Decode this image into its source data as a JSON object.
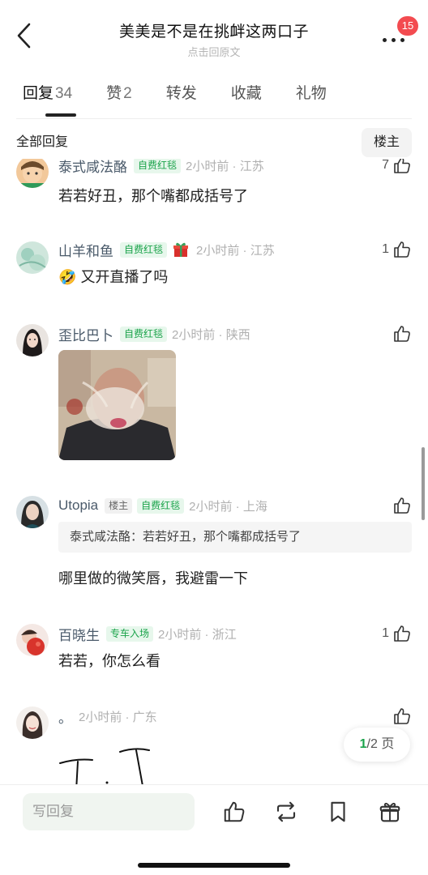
{
  "header": {
    "title": "美美是不是在挑衅这两口子",
    "subtitle": "点击回原文",
    "badge": "15"
  },
  "tabs": [
    {
      "label": "回复",
      "count": "34"
    },
    {
      "label": "赞",
      "count": "2"
    },
    {
      "label": "转发",
      "count": ""
    },
    {
      "label": "收藏",
      "count": ""
    },
    {
      "label": "礼物",
      "count": ""
    }
  ],
  "section": {
    "title": "全部回复",
    "owner_button": "楼主"
  },
  "comments": [
    {
      "name": "泰式咸法酪",
      "tag": "自费红毯",
      "time": "2小时前 · 江苏",
      "likes": "7",
      "text": "若若好丑，那个嘴都成括号了"
    },
    {
      "name": "山羊和鱼",
      "tag": "自费红毯",
      "time": "2小时前 · 江苏",
      "likes": "1",
      "emoji": "🤣",
      "text": "又开直播了吗"
    },
    {
      "name": "歪比巴卜",
      "tag": "自费红毯",
      "time": "2小时前 · 陕西",
      "likes": ""
    },
    {
      "name": "Utopia",
      "owner_tag": "楼主",
      "tag": "自费红毯",
      "time": "2小时前 · 上海",
      "likes": "",
      "quote": "泰式咸法酪：若若好丑，那个嘴都成括号了",
      "text": "哪里做的微笑唇，我避雷一下"
    },
    {
      "name": "百晓生",
      "tag": "专车入场",
      "time": "2小时前 · 浙江",
      "likes": "1",
      "text": "若若，你怎么看"
    },
    {
      "name": "。",
      "time": "2小时前 · 广东",
      "likes": ""
    }
  ],
  "pager": {
    "current": "1",
    "total": "/2 页"
  },
  "bottom": {
    "reply_placeholder": "写回复"
  },
  "colors": {
    "accent_green": "#1aa34a",
    "badge_red": "#f34b50",
    "username": "#4a5a6a"
  }
}
